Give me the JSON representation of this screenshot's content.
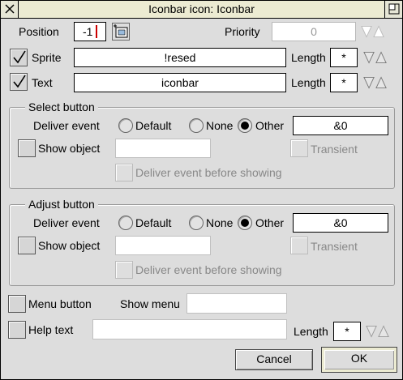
{
  "window": {
    "title": "Iconbar icon: Iconbar"
  },
  "position": {
    "label": "Position",
    "value": "-1"
  },
  "priority": {
    "label": "Priority",
    "value": "0"
  },
  "sprite": {
    "label": "Sprite",
    "checked": true,
    "value": "!resed",
    "length_label": "Length",
    "length_value": "*"
  },
  "text": {
    "label": "Text",
    "checked": true,
    "value": "iconbar",
    "length_label": "Length",
    "length_value": "*"
  },
  "select_button": {
    "group_label": "Select button",
    "deliver_label": "Deliver event",
    "options": [
      "Default",
      "None",
      "Other"
    ],
    "selected": "Other",
    "other_value": "&0",
    "show_object_label": "Show object",
    "show_object_value": "",
    "transient_label": "Transient",
    "deliver_before_label": "Deliver event before showing"
  },
  "adjust_button": {
    "group_label": "Adjust button",
    "deliver_label": "Deliver event",
    "options": [
      "Default",
      "None",
      "Other"
    ],
    "selected": "Other",
    "other_value": "&0",
    "show_object_label": "Show object",
    "show_object_value": "",
    "transient_label": "Transient",
    "deliver_before_label": "Deliver event before showing"
  },
  "menu": {
    "label": "Menu button",
    "show_menu_label": "Show menu",
    "show_menu_value": ""
  },
  "help": {
    "label": "Help text",
    "value": "",
    "length_label": "Length",
    "length_value": "*"
  },
  "buttons": {
    "cancel": "Cancel",
    "ok": "OK"
  },
  "colors": {
    "title_bg": "#ecebd2",
    "window_bg": "#dddddd",
    "caret": "#cc0000"
  }
}
